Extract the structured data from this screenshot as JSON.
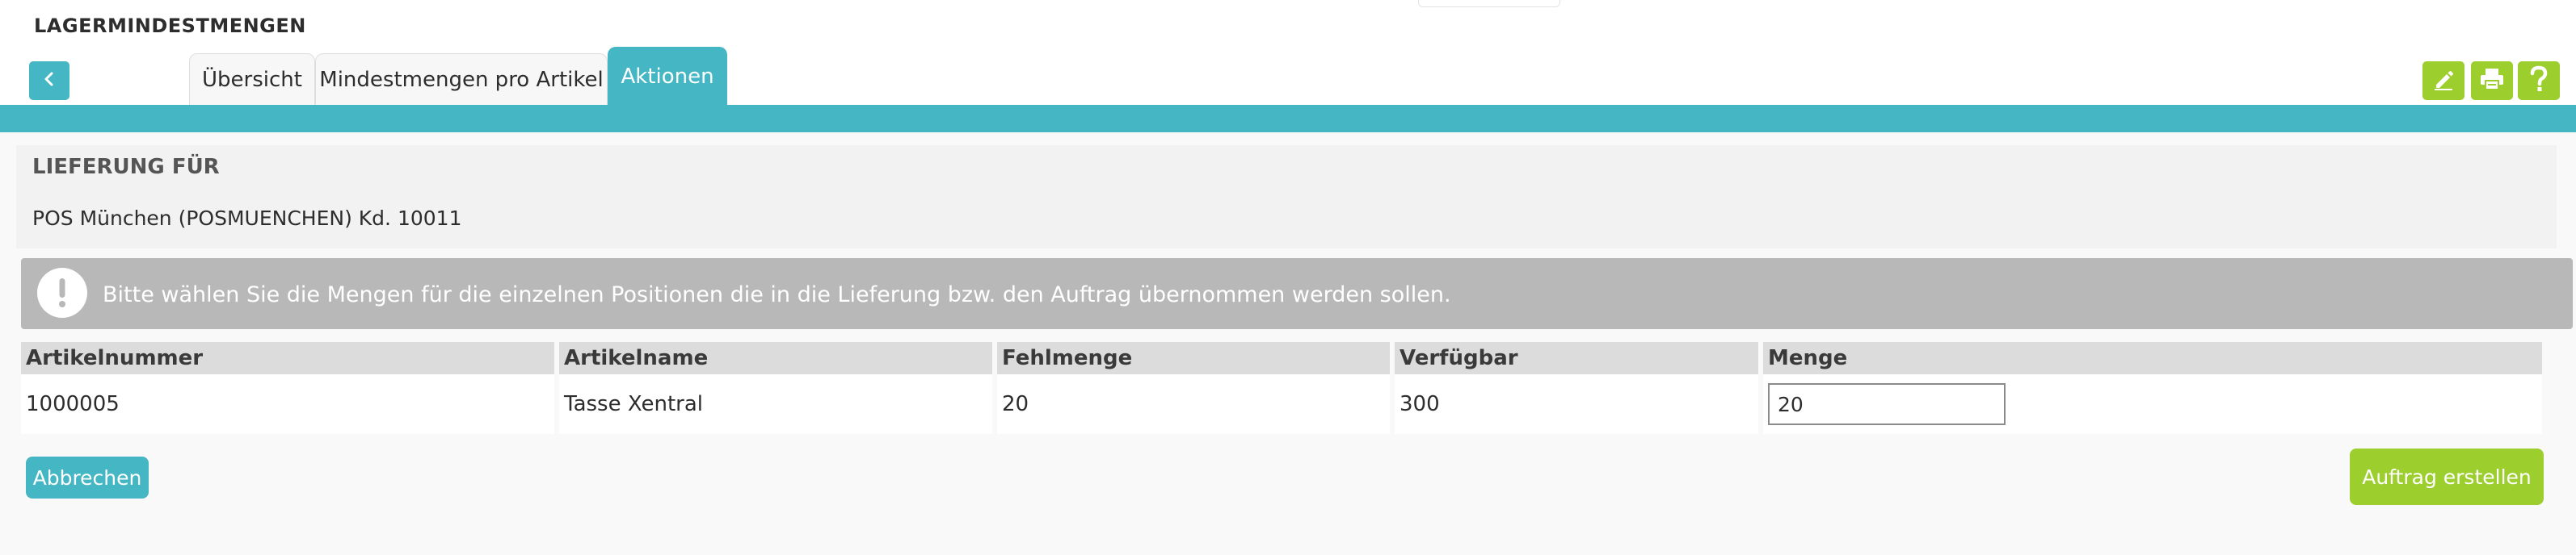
{
  "header": {
    "title": "LAGERMINDESTMENGEN"
  },
  "tabs": [
    {
      "label": "Übersicht",
      "active": false
    },
    {
      "label": "Mindestmengen pro Artikel",
      "active": false
    },
    {
      "label": "Aktionen",
      "active": true
    }
  ],
  "toolbar": {
    "icons": [
      "pencil-icon",
      "printer-icon",
      "help-icon"
    ]
  },
  "delivery": {
    "title": "LIEFERUNG FÜR",
    "customer": "POS München (POSMUENCHEN) Kd. 10011"
  },
  "info": {
    "message": "Bitte wählen Sie die Mengen für die einzelnen Positionen die in die Lieferung bzw. den Auftrag übernommen werden sollen."
  },
  "table": {
    "columns": [
      "Artikelnummer",
      "Artikelname",
      "Fehlmenge",
      "Verfügbar",
      "Menge"
    ],
    "rows": [
      {
        "artikelnummer": "1000005",
        "artikelname": "Tasse Xentral",
        "fehlmenge": "20",
        "verfuegbar": "300",
        "menge": "20"
      }
    ]
  },
  "actions": {
    "cancel": "Abbrechen",
    "create_order": "Auftrag erstellen"
  },
  "colors": {
    "accent": "#45b6c3",
    "action_green": "#9ccf2d",
    "info_gray": "#b8b8b8"
  }
}
